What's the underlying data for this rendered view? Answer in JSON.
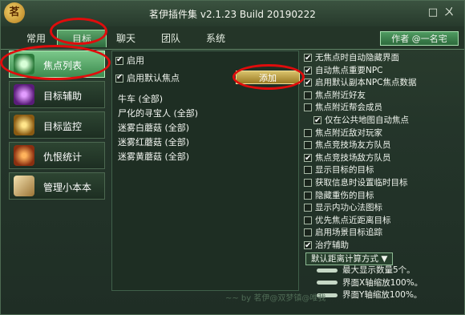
{
  "window": {
    "title": "茗伊插件集 v2.1.23 Build 20190222",
    "logo_char": "茗",
    "close_label": "ㄨ",
    "minimize_label": "□"
  },
  "tabs": [
    {
      "label": "常用"
    },
    {
      "label": "目标"
    },
    {
      "label": "聊天"
    },
    {
      "label": "团队"
    },
    {
      "label": "系统"
    }
  ],
  "author_button": "作者 @一名宅",
  "sidebar": [
    {
      "label": "焦点列表",
      "icon": "eye-icon"
    },
    {
      "label": "目标辅助",
      "icon": "target-rune-icon"
    },
    {
      "label": "目标监控",
      "icon": "monitor-claw-icon"
    },
    {
      "label": "仇恨统计",
      "icon": "hatred-flame-icon"
    },
    {
      "label": "管理小本本",
      "icon": "book-icon"
    }
  ],
  "panel": {
    "enable_label": "启用",
    "default_focus_label": "启用默认焦点",
    "add_button": "添加",
    "focus_list": [
      "牛车 (全部)",
      "尸化的寻宝人 (全部)",
      "迷雾白蘑菇 (全部)",
      "迷雾红蘑菇 (全部)",
      "迷雾黄蘑菇 (全部)"
    ]
  },
  "options": [
    {
      "label": "无焦点时自动隐藏界面",
      "checked": true
    },
    {
      "label": "自动焦点重要NPC",
      "checked": true
    },
    {
      "label": "启用默认副本NPC焦点数据",
      "checked": true
    },
    {
      "label": "焦点附近好友",
      "checked": false
    },
    {
      "label": "焦点附近帮会成员",
      "checked": false
    },
    {
      "label": "仅在公共地图自动焦点",
      "checked": true,
      "indent": true
    },
    {
      "label": "焦点附近敌对玩家",
      "checked": false
    },
    {
      "label": "焦点竞技场友方队员",
      "checked": false
    },
    {
      "label": "焦点竞技场敌方队员",
      "checked": true
    },
    {
      "label": "显示目标的目标",
      "checked": false
    },
    {
      "label": "获取信息时设置临时目标",
      "checked": false
    },
    {
      "label": "隐藏重伤的目标",
      "checked": false
    },
    {
      "label": "显示内功心法图标",
      "checked": false
    },
    {
      "label": "优先焦点近距离目标",
      "checked": false
    },
    {
      "label": "启用场景目标追踪",
      "checked": false
    },
    {
      "label": "治疗辅助",
      "checked": true
    }
  ],
  "distance_dropdown": "默认距离计算方式",
  "sliders": [
    "最大显示数量5个。",
    "界面X轴缩放100%。",
    "界面Y轴缩放100%。"
  ],
  "watermark": "~~ by 茗伊@双梦镇@唯我"
}
